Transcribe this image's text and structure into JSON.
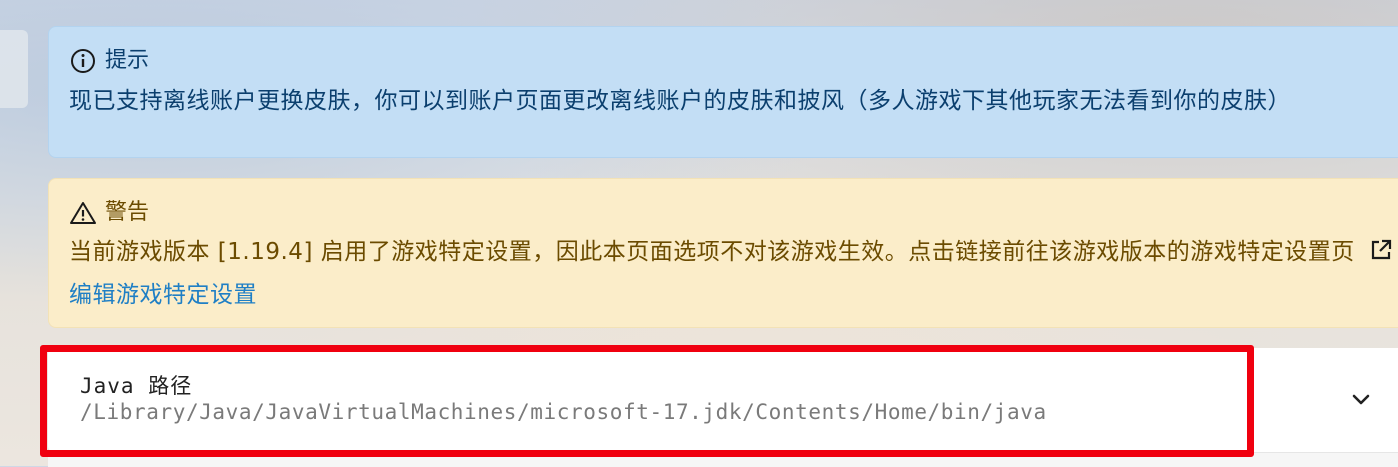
{
  "info_alert": {
    "title": "提示",
    "body": "现已支持离线账户更换皮肤，你可以到账户页面更改离线账户的皮肤和披风（多人游戏下其他玩家无法看到你的皮肤）",
    "icon": "info-circle-icon"
  },
  "warning_alert": {
    "title": "警告",
    "body": "当前游戏版本 [1.19.4] 启用了游戏特定设置，因此本页面选项不对该游戏生效。点击链接前往该游戏版本的游戏特定设置页",
    "link_label": "编辑游戏特定设置",
    "icon": "warning-triangle-icon",
    "link_icon": "external-link-icon"
  },
  "java_setting": {
    "title": "Java 路径",
    "value": "/Library/Java/JavaVirtualMachines/microsoft-17.jdk/Contents/Home/bin/java",
    "expand_icon": "chevron-down-icon"
  },
  "colors": {
    "info_bg": "#c3def5",
    "warning_bg": "#fbedc9",
    "link": "#1f7fc5",
    "highlight": "#f0000f"
  }
}
